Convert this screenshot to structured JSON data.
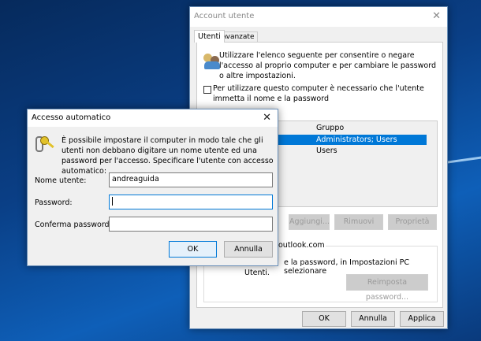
{
  "account_window": {
    "title": "Account utente",
    "tabs": [
      {
        "label": "Utenti",
        "active": true
      },
      {
        "label": "Avanzate",
        "active": false
      }
    ],
    "intro": "Utilizzare l'elenco seguente per consentire o negare l'accesso al proprio computer e per cambiare le password o altre impostazioni.",
    "require_login_checkbox": {
      "label": "Per utilizzare questo computer è necessario che l'utente immetta il nome e la password",
      "checked": false
    },
    "users_list": {
      "columns": [
        "Gruppo"
      ],
      "rows": [
        {
          "group": "Administrators; Users",
          "selected": true
        },
        {
          "group": "Users",
          "selected": false
        }
      ]
    },
    "buttons": {
      "add": "Aggiungi...",
      "remove": "Rimuovi",
      "properties": "Proprietà"
    },
    "password_group": {
      "title_visible": "outlook.com",
      "text_visible": "e la password, in Impostazioni PC selezionare",
      "text_line2": "Utenti.",
      "reset": "Reimposta password..."
    },
    "footer": {
      "ok": "OK",
      "cancel": "Annulla",
      "apply": "Applica"
    }
  },
  "auto_login_dialog": {
    "title": "Accesso automatico",
    "description": "È possibile impostare il computer in modo tale che gli utenti non debbano digitare un nome utente ed una password per l'accesso. Specificare l'utente con accesso automatico:",
    "fields": {
      "username_label": "Nome utente:",
      "username_value": "andreaguida",
      "password_label": "Password:",
      "password_value": "",
      "confirm_label": "Conferma password:",
      "confirm_value": ""
    },
    "ok": "OK",
    "cancel": "Annulla"
  },
  "colors": {
    "selection": "#0078d7",
    "accent_border": "#0078d7"
  }
}
